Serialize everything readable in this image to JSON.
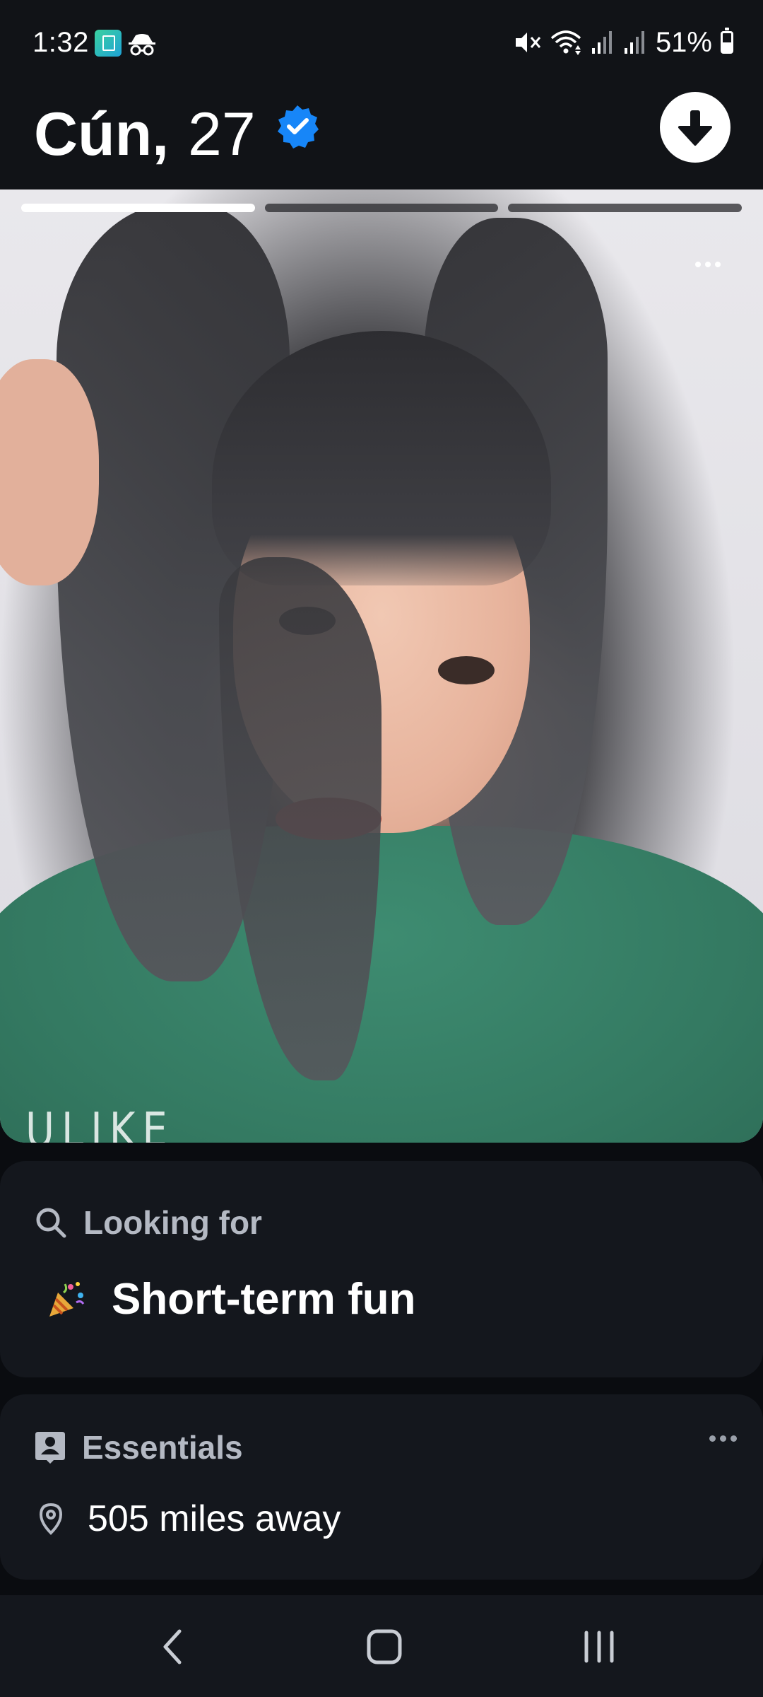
{
  "status_bar": {
    "time": "1:32",
    "battery": "51%",
    "battery_level": 0.51,
    "icons": [
      "app-notification-icon",
      "incognito-icon",
      "mute-icon",
      "wifi-icon",
      "signal-icon",
      "signal-icon",
      "battery-icon"
    ]
  },
  "profile": {
    "name": "Cún,",
    "age": "27",
    "verified": true,
    "accent_color": "#1786f8"
  },
  "photo": {
    "count": 3,
    "active_index": 0,
    "watermark": "ULIKE"
  },
  "looking_for": {
    "label": "Looking for",
    "value": "Short-term fun",
    "icon": "search-icon",
    "emoji": "party-popper"
  },
  "essentials": {
    "label": "Essentials",
    "distance": "505 miles away",
    "icon": "profile-card-icon"
  },
  "nav": {
    "items": [
      "back",
      "home",
      "recents"
    ]
  }
}
